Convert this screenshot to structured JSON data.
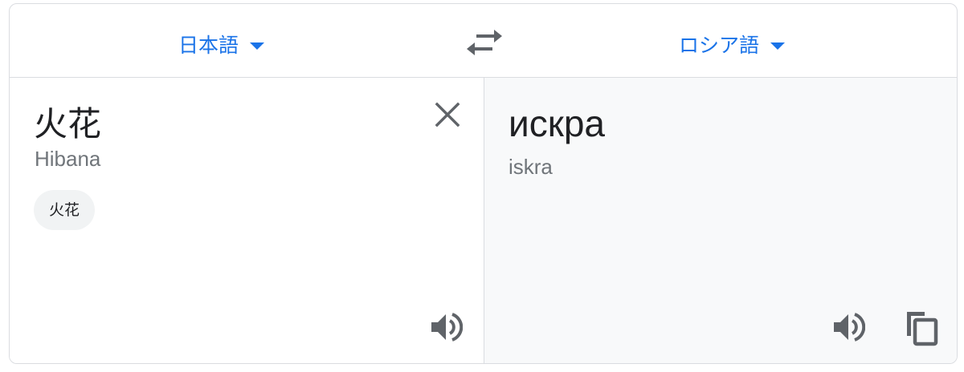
{
  "header": {
    "source_language": "日本語",
    "target_language": "ロシア語"
  },
  "source": {
    "text": "火花",
    "romanization": "Hibana",
    "suggestion_chip": "火花"
  },
  "target": {
    "text": "искра",
    "romanization": "iskra"
  },
  "icons": {
    "swap": "swap-arrows-icon",
    "clear": "close-icon",
    "listen_source": "speaker-icon",
    "listen_target": "speaker-icon",
    "copy": "copy-icon"
  },
  "colors": {
    "accent": "#1a73e8",
    "icon_gray": "#5f6368",
    "target_background": "#f8f9fa",
    "border": "#dadce0"
  }
}
